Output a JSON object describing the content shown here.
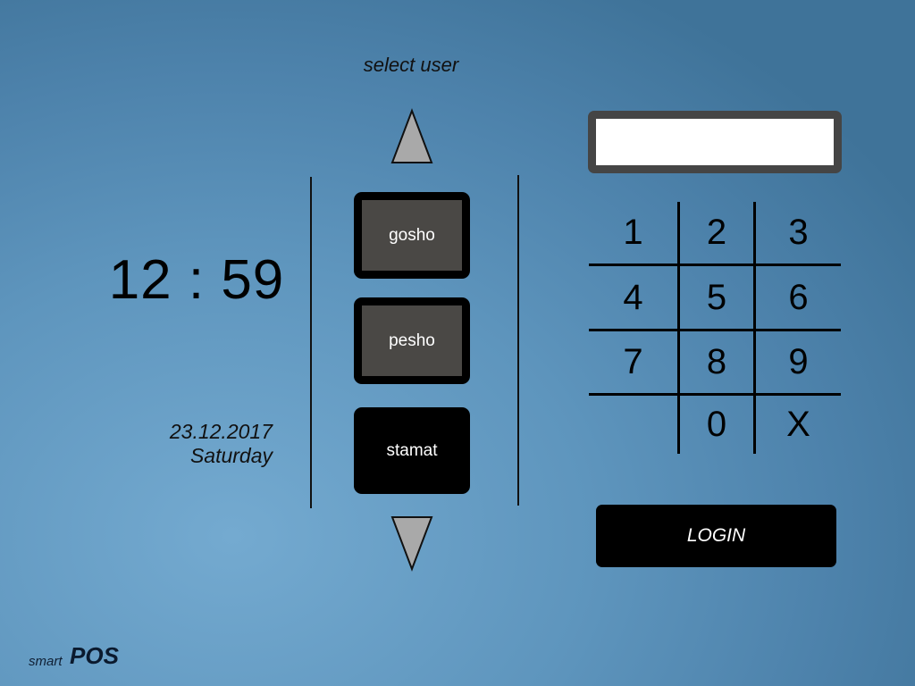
{
  "header": {
    "title": "select user"
  },
  "clock": {
    "time": "12 : 59",
    "date": "23.12.2017",
    "weekday": "Saturday"
  },
  "users": {
    "scroll_up_icon": "triangle-up-icon",
    "scroll_down_icon": "triangle-down-icon",
    "items": [
      {
        "label": "gosho",
        "state": "default"
      },
      {
        "label": "pesho",
        "state": "default"
      },
      {
        "label": "stamat",
        "state": "selected"
      }
    ]
  },
  "pin": {
    "value": ""
  },
  "keypad": {
    "keys": [
      "1",
      "2",
      "3",
      "4",
      "5",
      "6",
      "7",
      "8",
      "9",
      "",
      "0",
      "X"
    ]
  },
  "login": {
    "label": "LOGIN"
  },
  "brand": {
    "prefix": "smart",
    "name": "POS"
  },
  "colors": {
    "background": "#5e95bd",
    "button": "#000000",
    "button_inner": "#4a4845",
    "pin_border": "#454545",
    "arrow_fill": "#a9a9a9"
  }
}
